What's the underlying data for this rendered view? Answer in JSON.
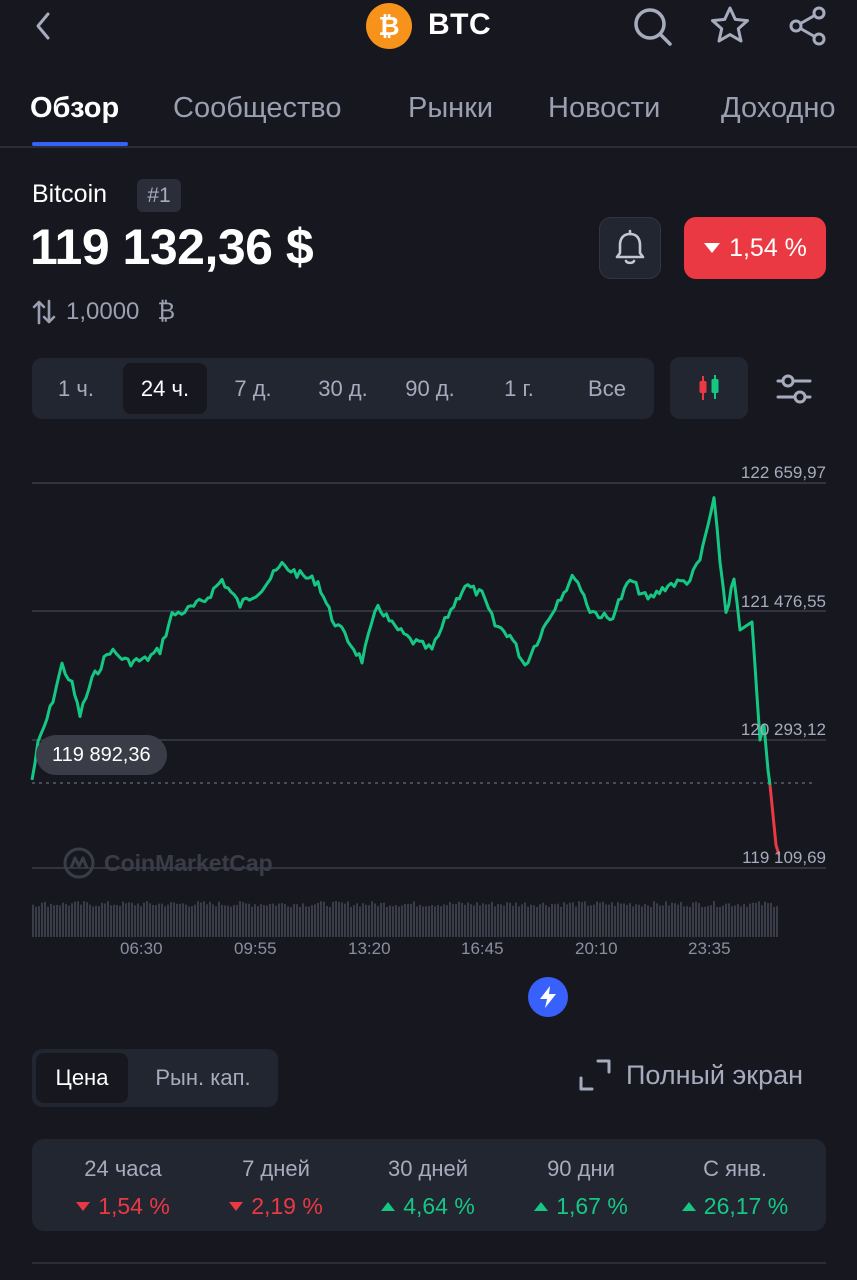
{
  "header": {
    "symbol": "BTC",
    "logo_glyph": "₿",
    "icons": [
      "back-icon",
      "search-icon",
      "star-icon",
      "share-icon"
    ]
  },
  "tabs": [
    "Обзор",
    "Сообщество",
    "Рынки",
    "Новости",
    "Доходно"
  ],
  "coin": {
    "name": "Bitcoin",
    "rank": "#1",
    "price": "119 132,36 $",
    "change": "1,54 %",
    "change_dir": "down",
    "swap_value": "1,0000",
    "swap_unit": "₿"
  },
  "range": {
    "items": [
      "1 ч.",
      "24 ч.",
      "7 д.",
      "30 д.",
      "90 д.",
      "1 г.",
      "Все"
    ],
    "selected": "24 ч."
  },
  "chart_data": {
    "type": "line",
    "y_ticks": [
      "122 659,97",
      "121 476,55",
      "120 293,12",
      "119 109,69"
    ],
    "x_ticks": [
      "06:30",
      "09:55",
      "13:20",
      "16:45",
      "20:10",
      "23:35"
    ],
    "start_label": "119 892,36",
    "watermark": "CoinMarketCap",
    "ylim": [
      119109.69,
      122659.97
    ],
    "colors": {
      "up": "#16c784",
      "down": "#ea3943"
    }
  },
  "toggle": {
    "items": [
      "Цена",
      "Рын. кап."
    ],
    "selected": "Цена"
  },
  "fullscreen_label": "Полный экран",
  "stats": [
    {
      "label": "24 часа",
      "value": "1,54 %",
      "dir": "down"
    },
    {
      "label": "7 дней",
      "value": "2,19 %",
      "dir": "down"
    },
    {
      "label": "30 дней",
      "value": "4,64 %",
      "dir": "up"
    },
    {
      "label": "90 дни",
      "value": "1,67 %",
      "dir": "up"
    },
    {
      "label": "С янв.",
      "value": "26,17 %",
      "dir": "up"
    }
  ]
}
